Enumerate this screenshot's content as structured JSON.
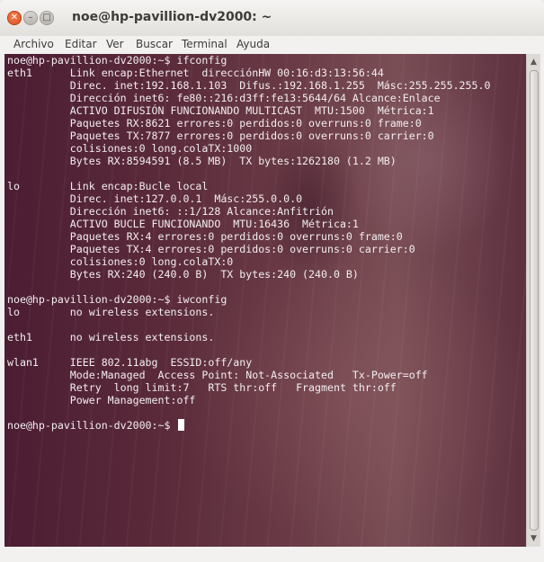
{
  "window": {
    "title": "noe@hp-pavillion-dv2000: ~"
  },
  "menu": [
    "Archivo",
    "Editar",
    "Ver",
    "Buscar",
    "Terminal",
    "Ayuda"
  ],
  "terminal": {
    "lines": [
      "noe@hp-pavillion-dv2000:~$ ifconfig",
      "eth1      Link encap:Ethernet  direcciónHW 00:16:d3:13:56:44",
      "          Direc. inet:192.168.1.103  Difus.:192.168.1.255  Másc:255.255.255.0",
      "          Dirección inet6: fe80::216:d3ff:fe13:5644/64 Alcance:Enlace",
      "          ACTIVO DIFUSIÓN FUNCIONANDO MULTICAST  MTU:1500  Métrica:1",
      "          Paquetes RX:8621 errores:0 perdidos:0 overruns:0 frame:0",
      "          Paquetes TX:7877 errores:0 perdidos:0 overruns:0 carrier:0",
      "          colisiones:0 long.colaTX:1000",
      "          Bytes RX:8594591 (8.5 MB)  TX bytes:1262180 (1.2 MB)",
      "",
      "lo        Link encap:Bucle local",
      "          Direc. inet:127.0.0.1  Másc:255.0.0.0",
      "          Dirección inet6: ::1/128 Alcance:Anfitrión",
      "          ACTIVO BUCLE FUNCIONANDO  MTU:16436  Métrica:1",
      "          Paquetes RX:4 errores:0 perdidos:0 overruns:0 frame:0",
      "          Paquetes TX:4 errores:0 perdidos:0 overruns:0 carrier:0",
      "          colisiones:0 long.colaTX:0",
      "          Bytes RX:240 (240.0 B)  TX bytes:240 (240.0 B)",
      "",
      "noe@hp-pavillion-dv2000:~$ iwconfig",
      "lo        no wireless extensions.",
      "",
      "eth1      no wireless extensions.",
      "",
      "wlan1     IEEE 802.11abg  ESSID:off/any",
      "          Mode:Managed  Access Point: Not-Associated   Tx-Power=off",
      "          Retry  long limit:7   RTS thr:off   Fragment thr:off",
      "          Power Management:off",
      "",
      "noe@hp-pavillion-dv2000:~$ "
    ]
  },
  "colors": {
    "terminal_text": "#f2eef0",
    "terminal_bg": "#5a2a3a",
    "close_button": "#e4602c"
  },
  "icons": {
    "close": "close-icon",
    "minimize": "minimize-icon",
    "maximize": "maximize-icon"
  }
}
